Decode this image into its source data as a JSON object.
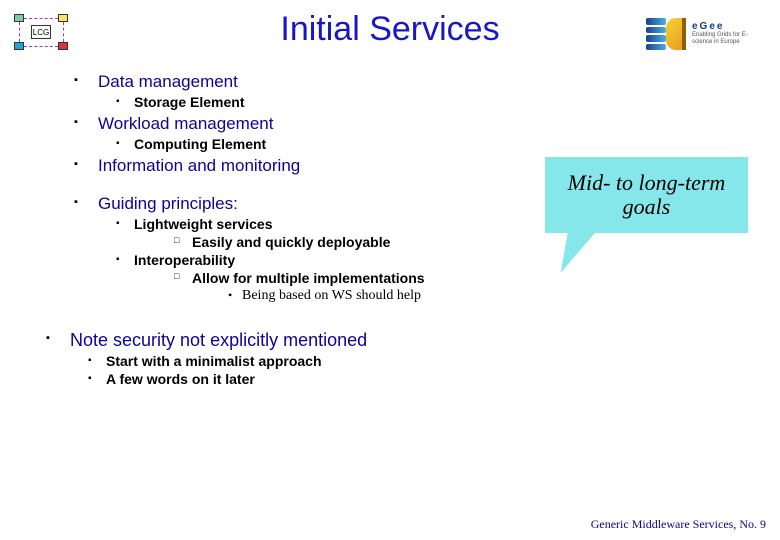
{
  "logo": {
    "lcg_label": "LCG"
  },
  "egee": {
    "big": "eGee",
    "small": "Enabling Grids for\nE-science in Europe"
  },
  "title": "Initial Services",
  "callout": "Mid- to long-term goals",
  "items": {
    "dm": "Data management",
    "dm_sub": "Storage Element",
    "wm": "Workload management",
    "wm_sub": "Computing Element",
    "im": "Information and monitoring",
    "gp": "Guiding principles:",
    "gp_lw": "Lightweight services",
    "gp_lw1": "Easily and quickly deployable",
    "gp_io": "Interoperability",
    "gp_io1": "Allow for multiple implementations",
    "gp_io2": "Being based on WS should help",
    "note": "Note security not explicitly mentioned",
    "note1": "Start with a minimalist approach",
    "note2": "A few words on it later"
  },
  "footer": "Generic Middleware Services, No. 9"
}
